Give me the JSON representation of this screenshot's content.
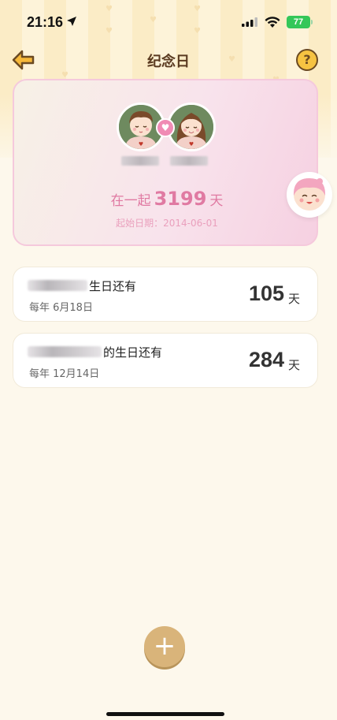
{
  "status": {
    "time": "21:16",
    "battery": "77"
  },
  "nav": {
    "title": "纪念日",
    "help_glyph": "?"
  },
  "couple": {
    "together_prefix": "在一起",
    "days": "3199",
    "days_unit": "天",
    "start_label": "起始日期：",
    "start_date": "2014-06-01"
  },
  "anniversaries": [
    {
      "title_suffix": "生日还有",
      "subtitle": "每年 6月18日",
      "days": "105",
      "unit": "天"
    },
    {
      "title_suffix": "的生日还有",
      "subtitle": "每年 12月14日",
      "days": "284",
      "unit": "天"
    }
  ],
  "add_button": {
    "glyph": "+"
  },
  "colors": {
    "accent_pink": "#e07aa2",
    "button_tan": "#d9b47a",
    "background": "#fdf8ec"
  }
}
